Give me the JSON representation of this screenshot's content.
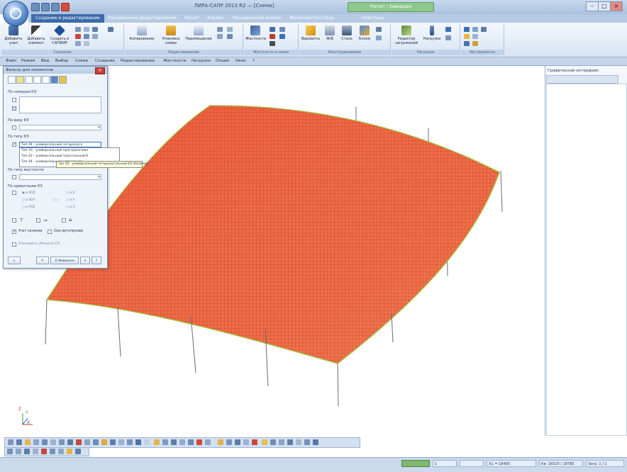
{
  "window": {
    "title": "ЛИРА-САПР 2013 R2 — [Схема]",
    "status_pill": "Расчет / Завершен"
  },
  "ribbon": {
    "tabs": [
      {
        "label": "Создание и редактирование",
        "active": true
      },
      {
        "label": "Расширенное редактирование"
      },
      {
        "label": "Расчет"
      },
      {
        "label": "Анализ"
      },
      {
        "label": "Расширенный анализ"
      },
      {
        "label": "Железобетон"
      },
      {
        "label": "Сталь"
      },
      {
        "label": "Пластины"
      }
    ],
    "groups": [
      {
        "label": "Создание",
        "buttons": [
          "Добавить узел",
          "Добавить элемент",
          "Создать в САПФИР"
        ]
      },
      {
        "label": "Редактирование",
        "buttons": [
          "Копирование",
          "Упаковка схемы",
          "Перемещение"
        ]
      },
      {
        "label": "Жесткости и связи",
        "buttons": [
          "Жесткости"
        ]
      },
      {
        "label": "Конструирование",
        "buttons": [
          "Варианты",
          "Ж/Б",
          "Сталь",
          "Блоки"
        ]
      },
      {
        "label": "Нагрузки",
        "buttons": [
          "Редактор загружений",
          "Нагрузки"
        ]
      },
      {
        "label": "Инструменты",
        "buttons": []
      }
    ]
  },
  "menubar": {
    "items": [
      "Файл",
      "Режим",
      "Вид",
      "Выбор",
      "Схема",
      "Создание",
      "Редактирование",
      "Жесткости",
      "Нагрузки",
      "Опции",
      "Окно",
      "?"
    ]
  },
  "filter_dialog": {
    "title": "Фильтр для элементов",
    "sections": {
      "by_number": "По номерам КЭ",
      "by_kind": "По виду КЭ",
      "by_type": "По типу КЭ",
      "by_stiffness": "По типу жесткости",
      "by_orientation": "По ориентации КЭ"
    },
    "type_selected": "Тип 44 - универсальный четырехуго",
    "type_options": [
      "Тип 10 - универсальный пространствен",
      "Тип 42 - универсальный треугольный К",
      "Тип 44 - универсальный четырехуго"
    ],
    "tooltip": "Тип 44 - универсальный четырехугольный КЭ оболочки",
    "orientation_options": [
      "в XOZ",
      "в XOY",
      "в YOZ",
      "в X",
      "в Y",
      "в Z",
      "="
    ],
    "checkboxes": {
      "group_elements": "Учет сечения",
      "orthotropy": "Оси ортотропии",
      "show_objects": "Учитывать объекты СЭ"
    },
    "buttons": {
      "apply": "",
      "inverse": "Инверсно",
      "close": "✕",
      "help": "?"
    }
  },
  "right_panel": {
    "title": "Графический интерфейс"
  },
  "viewport": {
    "axes": {
      "x": "X",
      "y": "Y",
      "z": "Z"
    },
    "mesh_color": "#e0502a",
    "edge_color": "#9ccc3c"
  },
  "statusbar": {
    "fields": [
      "",
      "1",
      "",
      "Х1 = 18490",
      "Кв: 18320 / 18785",
      "Загр: 1 / 1"
    ]
  }
}
